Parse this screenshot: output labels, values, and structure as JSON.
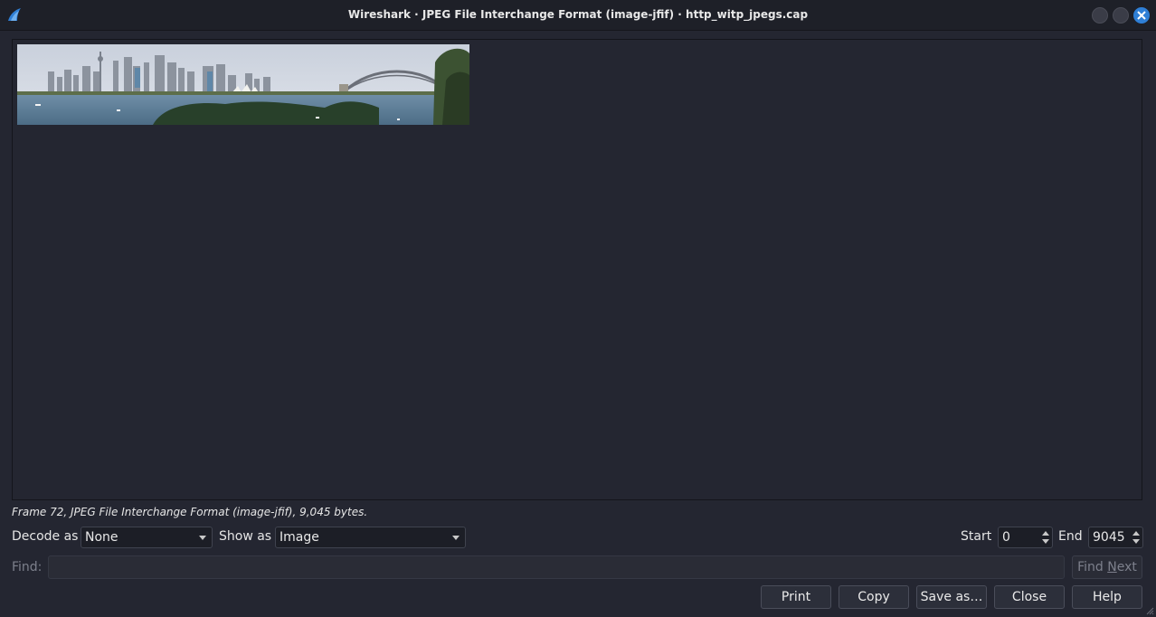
{
  "window": {
    "title": "Wireshark · JPEG File Interchange Format (image-jfif) · http_witp_jpegs.cap",
    "app_icon": "wireshark-fin-icon",
    "accent_color": "#2f7fd6"
  },
  "info_line": "Frame 72, JPEG File Interchange Format (image-jfif), 9,045 bytes.",
  "decode": {
    "label": "Decode as",
    "value": "None"
  },
  "show": {
    "label": "Show as",
    "value": "Image"
  },
  "range": {
    "start_label": "Start",
    "start_value": "0",
    "end_label": "End",
    "end_value": "9045"
  },
  "find": {
    "label": "Find:",
    "placeholder": "",
    "next_label_prefix": "Find ",
    "next_label_hotkey": "N",
    "next_label_suffix": "ext"
  },
  "buttons": {
    "print": "Print",
    "copy": "Copy",
    "save_as": "Save as…",
    "close": "Close",
    "help": "Help"
  }
}
